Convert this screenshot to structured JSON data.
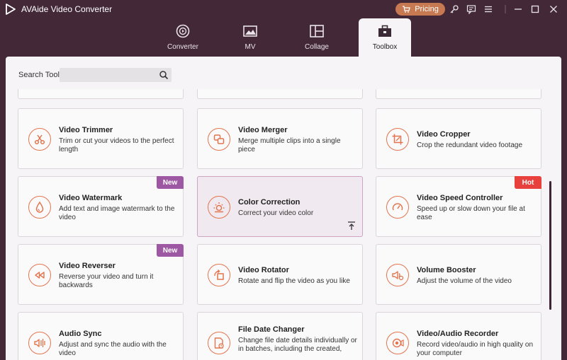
{
  "app": {
    "title": "AVAide Video Converter"
  },
  "titlebar": {
    "pricing_label": "Pricing",
    "accent": "#c77a52"
  },
  "tabs": [
    {
      "label": "Converter",
      "icon": "converter-icon"
    },
    {
      "label": "MV",
      "icon": "mv-icon"
    },
    {
      "label": "Collage",
      "icon": "collage-icon"
    },
    {
      "label": "Toolbox",
      "icon": "toolbox-icon",
      "active": true
    }
  ],
  "search": {
    "label": "Search Tool:",
    "value": "",
    "placeholder": ""
  },
  "tools": [
    {
      "title": "Video Trimmer",
      "desc": "Trim or cut your videos to the perfect length",
      "icon": "scissors-icon"
    },
    {
      "title": "Video Merger",
      "desc": "Merge multiple clips into a single piece",
      "icon": "merge-icon"
    },
    {
      "title": "Video Cropper",
      "desc": "Crop the redundant video footage",
      "icon": "crop-icon"
    },
    {
      "title": "Video Watermark",
      "desc": "Add text and image watermark to the video",
      "icon": "droplet-icon",
      "badge": "New"
    },
    {
      "title": "Color Correction",
      "desc": "Correct your video color",
      "icon": "sun-icon"
    },
    {
      "title": "Video Speed Controller",
      "desc": "Speed up or slow down your file at ease",
      "icon": "speedometer-icon",
      "badge": "Hot"
    },
    {
      "title": "Video Reverser",
      "desc": "Reverse your video and turn it backwards",
      "icon": "rewind-icon",
      "badge": "New"
    },
    {
      "title": "Video Rotator",
      "desc": "Rotate and flip the video as you like",
      "icon": "rotate-icon"
    },
    {
      "title": "Volume Booster",
      "desc": "Adjust the volume of the video",
      "icon": "volume-icon"
    },
    {
      "title": "Audio Sync",
      "desc": "Adjust and sync the audio with the video",
      "icon": "audio-sync-icon"
    },
    {
      "title": "File Date Changer",
      "desc": "Change file date details individually or in batches, including the created,",
      "icon": "file-date-icon"
    },
    {
      "title": "Video/Audio Recorder",
      "desc": "Record video/audio in high quality on your computer",
      "icon": "record-icon"
    }
  ],
  "colors": {
    "accent_orange": "#e2754d",
    "badge_new": "#9e58a3",
    "badge_hot": "#e8403c",
    "titlebar_bg": "#432838"
  }
}
